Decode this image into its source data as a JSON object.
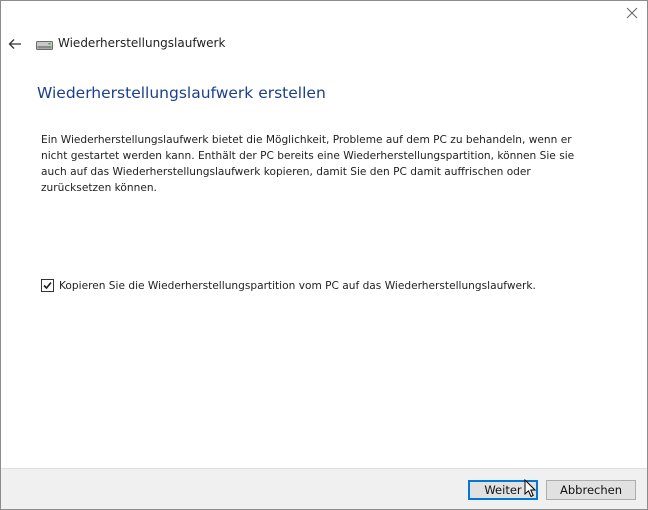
{
  "window": {
    "title": "Wiederherstellungslaufwerk"
  },
  "page": {
    "heading": "Wiederherstellungslaufwerk erstellen",
    "description": "Ein Wiederherstellungslaufwerk bietet die Möglichkeit, Probleme auf dem PC zu behandeln, wenn er nicht gestartet werden kann. Enthält der PC bereits eine Wiederherstellungspartition, können Sie sie auch auf das Wiederherstellungslaufwerk kopieren, damit Sie den PC damit auffrischen oder zurücksetzen können.",
    "checkbox": {
      "label": "Kopieren Sie die Wiederherstellungspartition vom PC auf das Wiederherstellungslaufwerk.",
      "checked": true
    }
  },
  "footer": {
    "next_label": "Weiter",
    "cancel_label": "Abbrechen"
  },
  "icons": {
    "close": "close-icon",
    "back": "back-arrow-icon",
    "drive": "drive-icon",
    "check": "checkmark-icon",
    "cursor": "mouse-cursor-icon"
  },
  "colors": {
    "heading": "#1b3f8f",
    "footer_bg": "#f0f0f0",
    "default_button_border": "#0078d7"
  }
}
